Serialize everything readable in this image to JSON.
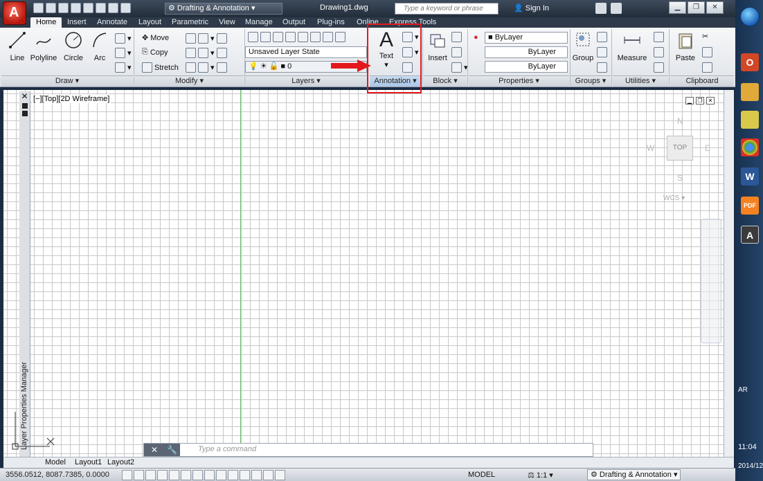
{
  "titlebar": {
    "workspace": "Drafting & Annotation",
    "doc_title": "Drawing1.dwg",
    "search_placeholder": "Type a keyword or phrase",
    "signin": "Sign In"
  },
  "tabs": [
    "Home",
    "Insert",
    "Annotate",
    "Layout",
    "Parametric",
    "View",
    "Manage",
    "Output",
    "Plug-ins",
    "Online",
    "Express Tools"
  ],
  "ribbon": {
    "draw": {
      "title": "Draw",
      "line": "Line",
      "polyline": "Polyline",
      "circle": "Circle",
      "arc": "Arc"
    },
    "modify": {
      "title": "Modify",
      "move": "Move",
      "copy": "Copy",
      "stretch": "Stretch"
    },
    "layers": {
      "title": "Layers",
      "layer_state": "Unsaved Layer State",
      "current_layer": "0"
    },
    "annotation": {
      "title": "Annotation",
      "text": "Text"
    },
    "block": {
      "title": "Block",
      "insert": "Insert"
    },
    "properties": {
      "title": "Properties",
      "color": "ByLayer",
      "linetype": "ByLayer",
      "lineweight": "ByLayer"
    },
    "groups": {
      "title": "Groups",
      "group": "Group"
    },
    "utilities": {
      "title": "Utilities",
      "measure": "Measure"
    },
    "clipboard": {
      "title": "Clipboard",
      "paste": "Paste"
    }
  },
  "viewport": {
    "header": "[−][Top][2D Wireframe]",
    "cube_top": "TOP",
    "cube_n": "N",
    "cube_s": "S",
    "cube_w": "W",
    "cube_e": "E",
    "wcs": "WCS"
  },
  "side_panel": "Layer Properties Manager",
  "command": {
    "placeholder": "Type a command"
  },
  "layout_tabs": [
    "Model",
    "Layout1",
    "Layout2"
  ],
  "status": {
    "coords": "3556.0512, 8087.7385, 0.0000",
    "model": "MODEL",
    "scale": "1:1",
    "workspace": "Drafting & Annotation"
  },
  "tray": {
    "lang": "AR",
    "time": "11:04",
    "date": "2014/12/"
  }
}
